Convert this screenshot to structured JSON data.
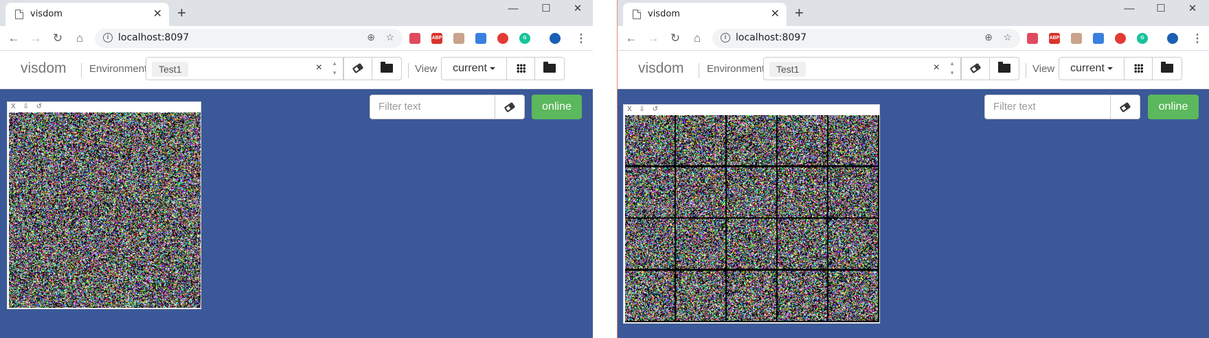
{
  "windows": [
    {
      "id": "left",
      "tab": {
        "title": "visdom",
        "close": "✕"
      },
      "new_tab": "+",
      "controls": [
        "—",
        "☐",
        "✕"
      ],
      "url": "localhost:8097",
      "visdom": {
        "brand": "visdom",
        "env_label": "Environment",
        "env_value": "Test1",
        "env_clear": "×",
        "view_label": "View",
        "view_value": "current",
        "filter_placeholder": "Filter text",
        "status": "online",
        "pane_controls": [
          "X",
          "⇩",
          "↺"
        ],
        "pane_grid": {
          "rows": 1,
          "cols": 1
        }
      }
    },
    {
      "id": "right",
      "tab": {
        "title": "visdom",
        "close": "✕"
      },
      "new_tab": "+",
      "controls": [
        "—",
        "☐",
        "✕"
      ],
      "url": "localhost:8097",
      "visdom": {
        "brand": "visdom",
        "env_label": "Environment",
        "env_value": "Test1",
        "env_clear": "×",
        "view_label": "View",
        "view_value": "current",
        "filter_placeholder": "Filter text",
        "status": "online",
        "pane_controls": [
          "X",
          "⇩",
          "↺"
        ],
        "pane_grid": {
          "rows": 4,
          "cols": 5
        }
      }
    }
  ],
  "toolbar_icons": {
    "back": "←",
    "forward": "→",
    "reload": "↻",
    "home": "⌂",
    "info": "i",
    "zoom": "⊕",
    "star": "☆",
    "menu": "⋮"
  },
  "extensions": [
    {
      "name": "pocket-icon",
      "label": "",
      "color": "#e04a5f"
    },
    {
      "name": "adblock-icon",
      "label": "ABP",
      "color": "#d9342b"
    },
    {
      "name": "pdf-icon",
      "label": "",
      "color": "#c9a38c"
    },
    {
      "name": "graduation-cap-icon",
      "label": "",
      "color": "#3b7fe0"
    },
    {
      "name": "stop-hand-icon",
      "label": "",
      "color": "#e53935"
    },
    {
      "name": "grammarly-icon",
      "label": "G",
      "color": "#15c39a"
    },
    {
      "name": "profile-icon",
      "label": "",
      "color": "#1a5fb4"
    }
  ],
  "colors": {
    "visdom_bg": "#3b5998",
    "online": "#5cb85c"
  }
}
